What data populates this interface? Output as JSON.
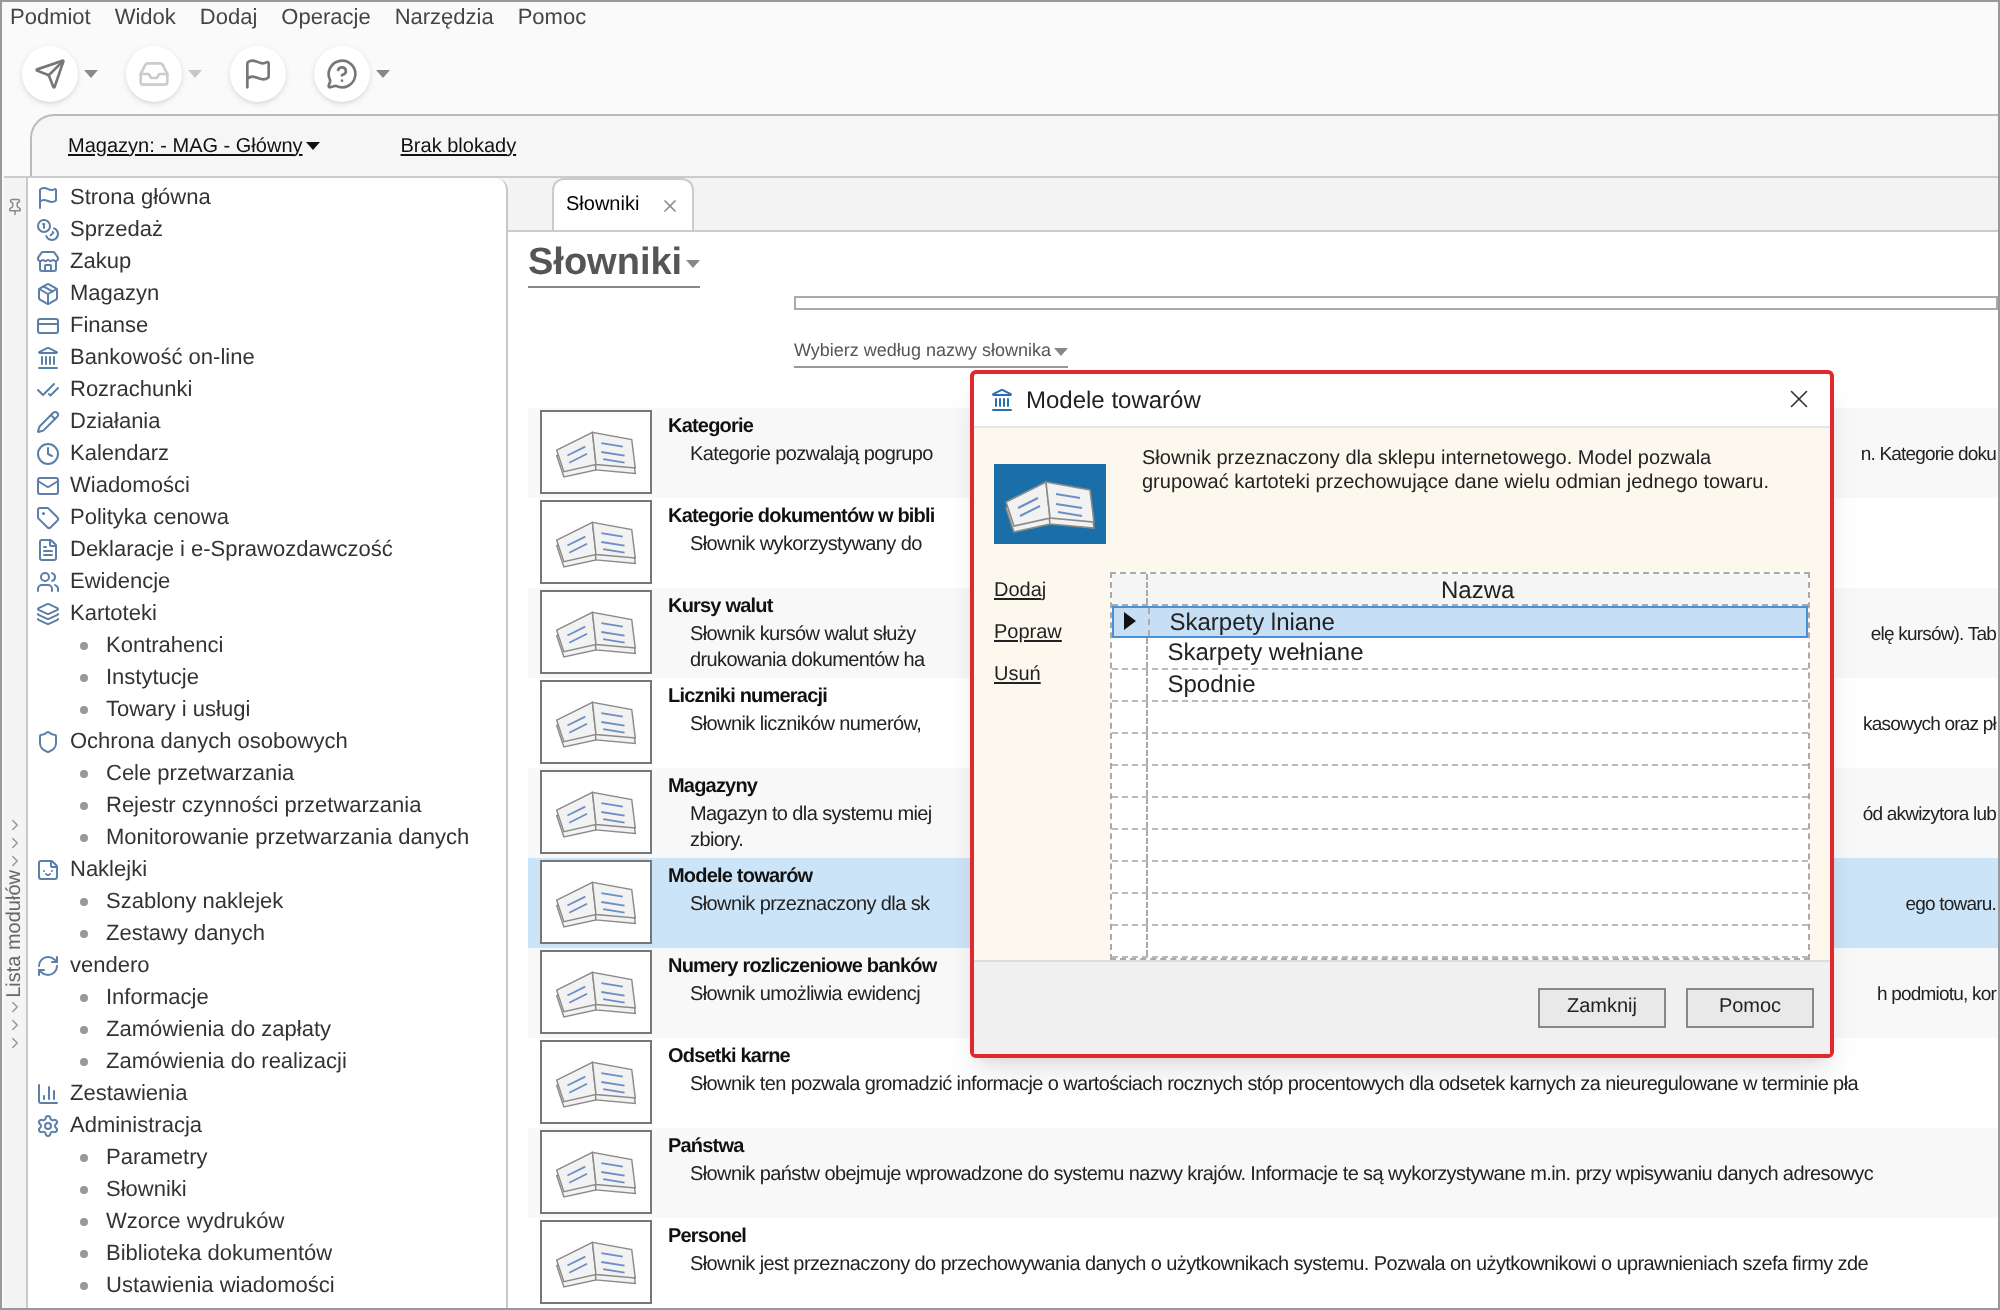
{
  "menu": [
    "Podmiot",
    "Widok",
    "Dodaj",
    "Operacje",
    "Narzędzia",
    "Pomoc"
  ],
  "toolbar": [
    {
      "disabled": false,
      "dropdown": true
    },
    {
      "disabled": true,
      "dropdown": true
    },
    {
      "disabled": false,
      "dropdown": false
    },
    {
      "disabled": false,
      "dropdown": true
    }
  ],
  "context_bar": {
    "warehouse": "Magazyn: - MAG - Główny",
    "lock": "Brak blokady"
  },
  "sidebar": {
    "title": "Lista modułów",
    "items": [
      {
        "label": "Strona główna"
      },
      {
        "label": "Sprzedaż"
      },
      {
        "label": "Zakup"
      },
      {
        "label": "Magazyn"
      },
      {
        "label": "Finanse"
      },
      {
        "label": "Bankowość on-line"
      },
      {
        "label": "Rozrachunki"
      },
      {
        "label": "Działania"
      },
      {
        "label": "Kalendarz"
      },
      {
        "label": "Wiadomości"
      },
      {
        "label": "Polityka cenowa"
      },
      {
        "label": "Deklaracje i e-Sprawozdawczość"
      },
      {
        "label": "Ewidencje"
      },
      {
        "label": "Kartoteki",
        "children": [
          {
            "label": "Kontrahenci"
          },
          {
            "label": "Instytucje"
          },
          {
            "label": "Towary i usługi"
          }
        ]
      },
      {
        "label": "Ochrona danych osobowych",
        "children": [
          {
            "label": "Cele przetwarzania"
          },
          {
            "label": "Rejestr czynności przetwarzania"
          },
          {
            "label": "Monitorowanie przetwarzania danych"
          }
        ]
      },
      {
        "label": "Naklejki",
        "children": [
          {
            "label": "Szablony naklejek"
          },
          {
            "label": "Zestawy danych"
          }
        ]
      },
      {
        "label": "vendero",
        "children": [
          {
            "label": "Informacje"
          },
          {
            "label": "Zamówienia do zapłaty"
          },
          {
            "label": "Zamówienia do realizacji"
          }
        ]
      },
      {
        "label": "Zestawienia"
      },
      {
        "label": "Administracja",
        "children": [
          {
            "label": "Parametry"
          },
          {
            "label": "Słowniki"
          },
          {
            "label": "Wzorce wydruków"
          },
          {
            "label": "Biblioteka dokumentów"
          },
          {
            "label": "Ustawienia wiadomości"
          }
        ]
      }
    ]
  },
  "tabs": [
    {
      "label": "Słowniki",
      "selected": true
    }
  ],
  "page": {
    "title": "Słowniki",
    "filter_link": "Wybierz według nazwy słownika"
  },
  "dictionaries": [
    {
      "title": "Kategorie",
      "selected": false,
      "lines": [
        {
          "left": "Kategorie pozwalają pogrupo",
          "right": "n. Kategorie doku"
        }
      ]
    },
    {
      "title": "Kategorie dokumentów w bibli",
      "selected": false,
      "lines": [
        {
          "left": "Słownik wykorzystywany do"
        }
      ]
    },
    {
      "title": "Kursy walut",
      "selected": false,
      "lines": [
        {
          "left": "Słownik kursów walut służy",
          "right": "elę kursów). Tab"
        },
        {
          "left": "drukowania dokumentów ha"
        }
      ]
    },
    {
      "title": "Liczniki numeracji",
      "selected": false,
      "lines": [
        {
          "left": "Słownik liczników numerów,",
          "right": "kasowych oraz pł"
        }
      ]
    },
    {
      "title": "Magazyny",
      "selected": false,
      "lines": [
        {
          "left": "Magazyn to dla systemu miej",
          "right": "ód akwizytora lub"
        },
        {
          "left": "zbiory."
        }
      ]
    },
    {
      "title": "Modele towarów",
      "selected": true,
      "lines": [
        {
          "left": "Słownik przeznaczony dla sk",
          "right": "ego towaru."
        }
      ]
    },
    {
      "title": "Numery rozliczeniowe banków",
      "selected": false,
      "lines": [
        {
          "left": "Słownik umożliwia ewidencj",
          "right": "h podmiotu, kor"
        }
      ]
    },
    {
      "title": "Odsetki karne",
      "selected": false,
      "lines": [
        {
          "left": "Słownik ten pozwala gromadzić informacje o wartościach rocznych stóp procentowych dla odsetek karnych za nieuregulowane w terminie pła"
        }
      ]
    },
    {
      "title": "Państwa",
      "selected": false,
      "lines": [
        {
          "left": "Słownik państw obejmuje wprowadzone do systemu nazwy krajów. Informacje te są wykorzystywane m.in. przy wpisywaniu danych adresowyc"
        }
      ]
    },
    {
      "title": "Personel",
      "selected": false,
      "lines": [
        {
          "left": "Słownik jest przeznaczony do przechowywania danych o użytkownikach systemu. Pozwala on użytkownikowi o uprawnieniach szefa firmy zde"
        }
      ]
    }
  ],
  "dialog": {
    "title": "Modele towarów",
    "description": "Słownik przeznaczony dla sklepu internetowego. Model pozwala grupować kartoteki przechowujące dane wielu odmian jednego towaru.",
    "actions": [
      "Dodaj",
      "Popraw",
      "Usuń"
    ],
    "grid": {
      "column": "Nazwa",
      "rows": [
        {
          "name": "Skarpety lniane",
          "selected": true
        },
        {
          "name": "Skarpety wełniane",
          "selected": false
        },
        {
          "name": "Spodnie",
          "selected": false
        }
      ]
    },
    "buttons": [
      "Zamknij",
      "Pomoc"
    ]
  }
}
